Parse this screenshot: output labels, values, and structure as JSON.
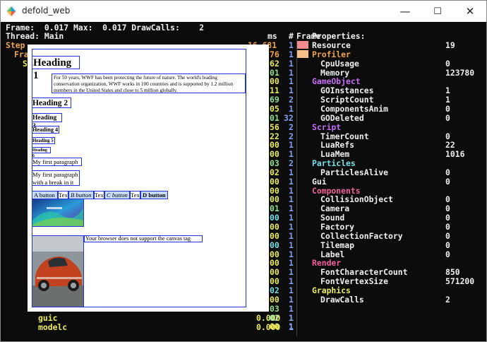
{
  "window": {
    "title": "defold_web",
    "min_glyph": "—",
    "max_glyph": "☐",
    "close_glyph": "✕",
    "app_icon": "defold-logo-icon"
  },
  "profiler": {
    "line1": "Frame:  0.017 Max:  0.017 DrawCalls:    2",
    "line2": "Thread: Main",
    "col_ms": "ms",
    "col_hash": "#",
    "col_frame": "Frame",
    "step_label": "Step",
    "frame_label": "Fra",
    "s_label": "S",
    "tail_rows": [
      {
        "name": "guic",
        "value": "0.000",
        "count": "1"
      },
      {
        "name": "modelc",
        "value": "0.000",
        "count": "1"
      }
    ],
    "visible_numbers": [
      {
        "ms": "16.681",
        "cnt": "1"
      },
      {
        "ms": "76",
        "cnt": "1"
      },
      {
        "ms": "62",
        "cnt": "1"
      },
      {
        "ms": "01",
        "cnt": "1"
      },
      {
        "ms": "00",
        "cnt": "1"
      },
      {
        "ms": "11",
        "cnt": "1"
      },
      {
        "ms": "69",
        "cnt": "2"
      },
      {
        "ms": "05",
        "cnt": "1"
      },
      {
        "ms": "01",
        "cnt": "32"
      },
      {
        "ms": "56",
        "cnt": "2"
      },
      {
        "ms": "22",
        "cnt": "2"
      },
      {
        "ms": "00",
        "cnt": "1"
      },
      {
        "ms": "00",
        "cnt": "1"
      },
      {
        "ms": "03",
        "cnt": "2"
      },
      {
        "ms": "02",
        "cnt": "1"
      },
      {
        "ms": "00",
        "cnt": "1"
      },
      {
        "ms": "00",
        "cnt": "1"
      },
      {
        "ms": "00",
        "cnt": "1"
      },
      {
        "ms": "01",
        "cnt": "1"
      },
      {
        "ms": "00",
        "cnt": "1"
      },
      {
        "ms": "00",
        "cnt": "1"
      },
      {
        "ms": "00",
        "cnt": "1"
      },
      {
        "ms": "00",
        "cnt": "1"
      },
      {
        "ms": "00",
        "cnt": "1"
      },
      {
        "ms": "00",
        "cnt": "1"
      },
      {
        "ms": "00",
        "cnt": "1"
      },
      {
        "ms": "00",
        "cnt": "1"
      },
      {
        "ms": "02",
        "cnt": "1"
      },
      {
        "ms": "00",
        "cnt": "1"
      },
      {
        "ms": "03",
        "cnt": "1"
      },
      {
        "ms": "02",
        "cnt": "1"
      },
      {
        "ms": "00",
        "cnt": "1"
      }
    ]
  },
  "properties": {
    "header": "Properties:",
    "rows": [
      {
        "label": "Resource",
        "value": "19",
        "kind": "white",
        "indent": 0
      },
      {
        "label": "Profiler",
        "value": "",
        "kind": "orange",
        "indent": 0
      },
      {
        "label": "CpuUsage",
        "value": "0",
        "kind": "white",
        "indent": 1
      },
      {
        "label": "Memory",
        "value": "123780",
        "kind": "white",
        "indent": 1
      },
      {
        "label": "GameObject",
        "value": "",
        "kind": "purple",
        "indent": 0
      },
      {
        "label": "GOInstances",
        "value": "1",
        "kind": "white",
        "indent": 1
      },
      {
        "label": "ScriptCount",
        "value": "1",
        "kind": "white",
        "indent": 1
      },
      {
        "label": "ComponentsAnim",
        "value": "0",
        "kind": "white",
        "indent": 1
      },
      {
        "label": "GODeleted",
        "value": "0",
        "kind": "white",
        "indent": 1
      },
      {
        "label": "Script",
        "value": "",
        "kind": "purple",
        "indent": 0
      },
      {
        "label": "TimerCount",
        "value": "0",
        "kind": "white",
        "indent": 1
      },
      {
        "label": "LuaRefs",
        "value": "22",
        "kind": "white",
        "indent": 1
      },
      {
        "label": "LuaMem",
        "value": "1016",
        "kind": "white",
        "indent": 1
      },
      {
        "label": "Particles",
        "value": "",
        "kind": "cyan",
        "indent": 0
      },
      {
        "label": "ParticlesAlive",
        "value": "0",
        "kind": "white",
        "indent": 1
      },
      {
        "label": "Gui",
        "value": "0",
        "kind": "white",
        "indent": 0
      },
      {
        "label": "Components",
        "value": "",
        "kind": "pink",
        "indent": 0
      },
      {
        "label": "CollisionObject",
        "value": "0",
        "kind": "white",
        "indent": 1
      },
      {
        "label": "Camera",
        "value": "0",
        "kind": "white",
        "indent": 1
      },
      {
        "label": "Sound",
        "value": "0",
        "kind": "white",
        "indent": 1
      },
      {
        "label": "Factory",
        "value": "0",
        "kind": "white",
        "indent": 1
      },
      {
        "label": "CollectionFactory",
        "value": "0",
        "kind": "white",
        "indent": 1
      },
      {
        "label": "Tilemap",
        "value": "0",
        "kind": "white",
        "indent": 1
      },
      {
        "label": "Label",
        "value": "0",
        "kind": "white",
        "indent": 1
      },
      {
        "label": "Render",
        "value": "",
        "kind": "pink",
        "indent": 0
      },
      {
        "label": "FontCharacterCount",
        "value": "850",
        "kind": "white",
        "indent": 1
      },
      {
        "label": "FontVertexSize",
        "value": "571200",
        "kind": "white",
        "indent": 1
      },
      {
        "label": "Graphics",
        "value": "",
        "kind": "yellow",
        "indent": 0
      },
      {
        "label": "DrawCalls",
        "value": "2",
        "kind": "white",
        "indent": 1
      }
    ],
    "swatches": {
      "resource": "#f28b8b",
      "profiler": "#f5c08a"
    }
  },
  "webpage": {
    "heading1": "Heading 1",
    "paragraph": "For 50 years, WWF has been protecting the future of nature. The world's leading conservation organization, WWF works in 100 countries and is supported by 1.2 million members in the United States and close to 5 million globally.",
    "heading2": "Heading 2",
    "heading3": "Heading 3",
    "heading4": "Heading 4",
    "heading5": "Heading 5",
    "heading6": "Heading 6",
    "para_first": "My first paragraph",
    "para_break_1": "My first paragraph",
    "para_break_2": "with a break in it",
    "button_a": "A button",
    "text_1": "Text",
    "button_b": "B button",
    "text_2": "Text",
    "button_c": "C button",
    "text_3": "Text",
    "button_d": "D button",
    "canvas_fallback": "Your browser does not support the canvas tag"
  }
}
